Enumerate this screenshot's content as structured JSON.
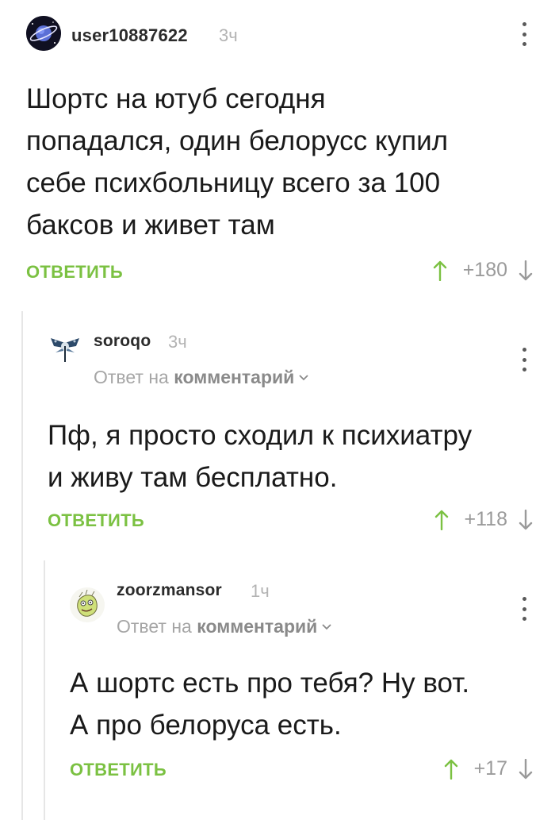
{
  "comments": [
    {
      "username": "user10887622",
      "time": "3ч",
      "body_lines": [
        "Шортс на ютуб сегодня",
        "попадался, один белорусс купил",
        "себе психбольницу всего за 100",
        "баксов и живет там"
      ],
      "reply_label": "ОТВЕТИТЬ",
      "score": "+180"
    },
    {
      "username": "soroqo",
      "time": "3ч",
      "reply_to_prefix": "Ответ на",
      "reply_to_target": "комментарий",
      "body_lines": [
        "Пф, я просто сходил к психиатру",
        "и живу там бесплатно."
      ],
      "reply_label": "ОТВЕТИТЬ",
      "score": "+118"
    },
    {
      "username": "zoorzmansor",
      "time": "1ч",
      "reply_to_prefix": "Ответ на",
      "reply_to_target": "комментарий",
      "body_lines": [
        "А шортс есть про тебя? Ну вот.",
        "А про белоруса есть."
      ],
      "reply_label": "ОТВЕТИТЬ",
      "score": "+17"
    }
  ],
  "icons": {
    "more": "more-vertical-icon",
    "upvote": "arrow-up-icon",
    "downvote": "arrow-down-icon",
    "chevron": "chevron-down-icon"
  },
  "colors": {
    "accent_green": "#7bc142",
    "muted_gray": "#9a9a9a",
    "thread_line": "#e6e6e6"
  }
}
